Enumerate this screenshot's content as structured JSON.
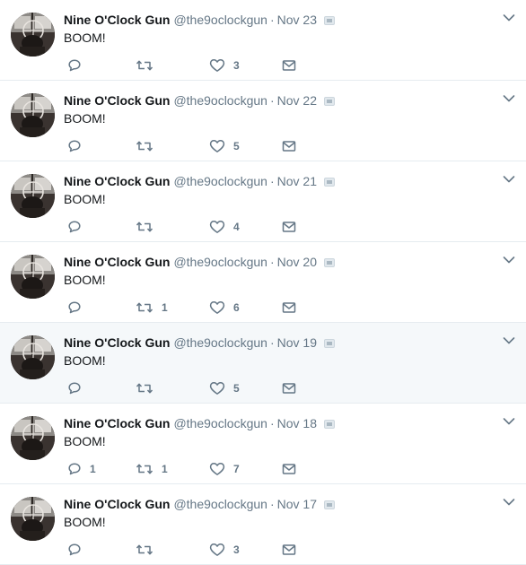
{
  "colors": {
    "text": "#14171a",
    "secondary": "#657786",
    "divider": "#e6ecf0",
    "hover_background": "#f5f8fa"
  },
  "icons": {
    "reply": "reply-icon",
    "retweet": "retweet-icon",
    "like": "heart-icon",
    "direct_message": "envelope-icon",
    "menu": "chevron-down-icon",
    "badge": "gray-badge-icon",
    "avatar": "nine-oclock-gun-avatar"
  },
  "tweets": [
    {
      "fullname": "Nine O'Clock Gun",
      "username": "@the9oclockgun",
      "separator": "·",
      "date": "Nov 23",
      "text": "BOOM!",
      "replies": "",
      "retweets": "",
      "likes": "3",
      "hovered": false
    },
    {
      "fullname": "Nine O'Clock Gun",
      "username": "@the9oclockgun",
      "separator": "·",
      "date": "Nov 22",
      "text": "BOOM!",
      "replies": "",
      "retweets": "",
      "likes": "5",
      "hovered": false
    },
    {
      "fullname": "Nine O'Clock Gun",
      "username": "@the9oclockgun",
      "separator": "·",
      "date": "Nov 21",
      "text": "BOOM!",
      "replies": "",
      "retweets": "",
      "likes": "4",
      "hovered": false
    },
    {
      "fullname": "Nine O'Clock Gun",
      "username": "@the9oclockgun",
      "separator": "·",
      "date": "Nov 20",
      "text": "BOOM!",
      "replies": "",
      "retweets": "1",
      "likes": "6",
      "hovered": false
    },
    {
      "fullname": "Nine O'Clock Gun",
      "username": "@the9oclockgun",
      "separator": "·",
      "date": "Nov 19",
      "text": "BOOM!",
      "replies": "",
      "retweets": "",
      "likes": "5",
      "hovered": true
    },
    {
      "fullname": "Nine O'Clock Gun",
      "username": "@the9oclockgun",
      "separator": "·",
      "date": "Nov 18",
      "text": "BOOM!",
      "replies": "1",
      "retweets": "1",
      "likes": "7",
      "hovered": false
    },
    {
      "fullname": "Nine O'Clock Gun",
      "username": "@the9oclockgun",
      "separator": "·",
      "date": "Nov 17",
      "text": "BOOM!",
      "replies": "",
      "retweets": "",
      "likes": "3",
      "hovered": false
    }
  ]
}
